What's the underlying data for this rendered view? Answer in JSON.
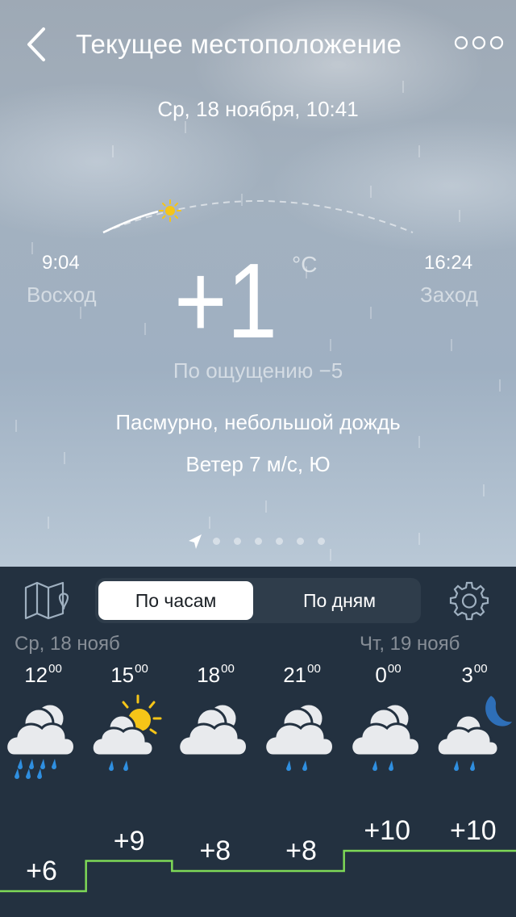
{
  "header": {
    "title": "Текущее местоположение",
    "back_icon": "chevron-left-icon",
    "more_icon": "more-dots-icon"
  },
  "current": {
    "datetime": "Ср, 18 ноября, 10:41",
    "sunrise_time": "9:04",
    "sunrise_label": "Восход",
    "sunset_time": "16:24",
    "sunset_label": "Заход",
    "temperature": "+1",
    "unit": "°C",
    "feels_like": "По ощущению −5",
    "condition": "Пасмурно, небольшой дождь",
    "wind": "Ветер 7 м/с, Ю",
    "sun_progress": 0.22
  },
  "pager": {
    "pages": 7,
    "active": 0
  },
  "toolbar": {
    "hourly_label": "По часам",
    "daily_label": "По дням",
    "map_icon": "map-icon",
    "settings_icon": "gear-icon"
  },
  "forecast": {
    "day1_label": "Ср, 18 нояб",
    "day2_label": "Чт, 19 нояб",
    "hours": [
      {
        "hour": "12",
        "minutes": "00",
        "icon": "cloud-heavy-rain-icon",
        "temp": "+6"
      },
      {
        "hour": "15",
        "minutes": "00",
        "icon": "sun-cloud-rain-icon",
        "temp": "+9"
      },
      {
        "hour": "18",
        "minutes": "00",
        "icon": "cloudy-icon",
        "temp": "+8"
      },
      {
        "hour": "21",
        "minutes": "00",
        "icon": "cloud-rain-icon",
        "temp": "+8"
      },
      {
        "hour": "0",
        "minutes": "00",
        "icon": "cloud-rain-icon",
        "temp": "+10"
      },
      {
        "hour": "3",
        "minutes": "00",
        "icon": "moon-cloud-rain-icon",
        "temp": "+10"
      }
    ]
  },
  "colors": {
    "panel": "#233140",
    "graph_line": "#7ed957",
    "rain_drop": "#2f8fe0",
    "sun": "#f5c518"
  }
}
